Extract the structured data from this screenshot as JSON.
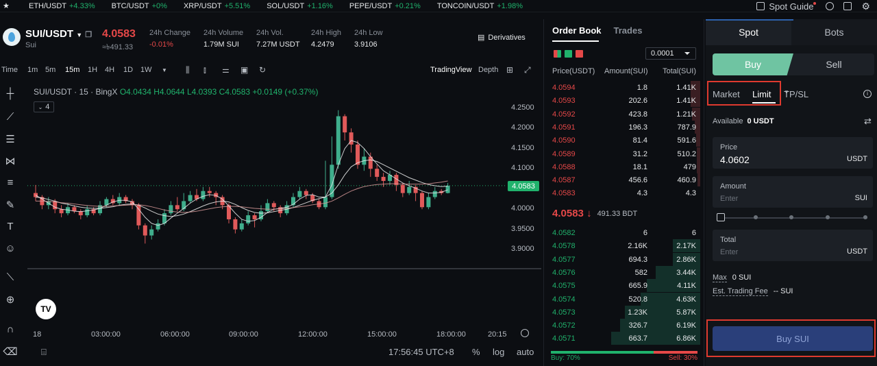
{
  "ticker": [
    {
      "pair": "ETH/USDT",
      "chg": "+4.33%"
    },
    {
      "pair": "BTC/USDT",
      "chg": "+0%"
    },
    {
      "pair": "XRP/USDT",
      "chg": "+5.51%"
    },
    {
      "pair": "SOL/USDT",
      "chg": "+1.16%"
    },
    {
      "pair": "PEPE/USDT",
      "chg": "+0.21%"
    },
    {
      "pair": "TONCOIN/USDT",
      "chg": "+1.98%"
    }
  ],
  "top": {
    "spot_guide": "Spot Guide"
  },
  "header": {
    "pair": "SUI/USDT",
    "sub": "Sui",
    "price": "4.0583",
    "price_sub": "≈৳491.33",
    "stats": [
      {
        "label": "24h Change",
        "value": "-0.01%",
        "neg": true
      },
      {
        "label": "24h Volume",
        "value": "1.79M SUI"
      },
      {
        "label": "24h Vol.",
        "value": "7.27M USDT"
      },
      {
        "label": "24h High",
        "value": "4.2479"
      },
      {
        "label": "24h Low",
        "value": "3.9106"
      }
    ],
    "derivatives": "Derivatives"
  },
  "toolbar": {
    "time": "Time",
    "intervals": [
      "1m",
      "5m",
      "15m",
      "1H",
      "4H",
      "1D",
      "1W"
    ],
    "active": "15m",
    "tradingview": "TradingView",
    "depth": "Depth"
  },
  "legend": {
    "title": "SUI/USDT · 15 · BingX",
    "o": "O4.0434",
    "h": "H4.0644",
    "l": "L4.0393",
    "c": "C4.0583",
    "chg": "+0.0149 (+0.37%)",
    "ind_count": "4"
  },
  "chart_data": {
    "type": "candlestick",
    "title": "SUI/USDT · 15 · BingX",
    "y_ticks": [
      "4.2500",
      "4.2000",
      "4.1500",
      "4.1000",
      "4.0500",
      "4.0000",
      "3.9500",
      "3.9000"
    ],
    "ylim": [
      3.88,
      4.27
    ],
    "x_ticks": [
      "18",
      "03:00:00",
      "06:00:00",
      "09:00:00",
      "12:00:00",
      "15:00:00",
      "18:00:00",
      "20:15"
    ],
    "current_price": "4.0583",
    "candles": [
      [
        4.04,
        4.03,
        4.06,
        4.02
      ],
      [
        4.03,
        4.01,
        4.035,
        4.0
      ],
      [
        4.01,
        4.02,
        4.03,
        4.0
      ],
      [
        4.02,
        4.0,
        4.025,
        3.99
      ],
      [
        4.0,
        3.99,
        4.01,
        3.98
      ],
      [
        3.99,
        4.005,
        4.015,
        3.985
      ],
      [
        4.005,
        3.995,
        4.01,
        3.99
      ],
      [
        3.995,
        3.985,
        4.0,
        3.975
      ],
      [
        3.985,
        4.0,
        4.01,
        3.98
      ],
      [
        4.0,
        3.99,
        4.005,
        3.985
      ],
      [
        3.99,
        4.01,
        4.02,
        3.985
      ],
      [
        4.01,
        4.025,
        4.03,
        4.005
      ],
      [
        4.025,
        4.015,
        4.035,
        4.01
      ],
      [
        4.015,
        4.03,
        4.04,
        4.01
      ],
      [
        4.03,
        4.02,
        4.035,
        4.015
      ],
      [
        4.02,
        4.01,
        4.025,
        4.0
      ],
      [
        4.01,
        3.96,
        4.015,
        3.95
      ],
      [
        3.96,
        3.935,
        3.965,
        3.915
      ],
      [
        3.935,
        3.95,
        3.96,
        3.925
      ],
      [
        3.95,
        3.965,
        3.975,
        3.945
      ],
      [
        3.965,
        3.99,
        4.0,
        3.96
      ],
      [
        3.99,
        4.01,
        4.02,
        3.985
      ],
      [
        4.01,
        4.0,
        4.03,
        3.995
      ],
      [
        4.0,
        4.02,
        4.04,
        3.995
      ],
      [
        4.02,
        4.035,
        4.045,
        4.015
      ],
      [
        4.035,
        4.025,
        4.05,
        4.02
      ],
      [
        4.025,
        4.045,
        4.055,
        4.02
      ],
      [
        4.045,
        4.04,
        4.055,
        4.03
      ],
      [
        4.04,
        4.03,
        4.045,
        4.01
      ],
      [
        4.03,
        4.01,
        4.035,
        4.0
      ],
      [
        4.01,
        3.975,
        4.015,
        3.965
      ],
      [
        3.975,
        3.95,
        3.98,
        3.94
      ],
      [
        3.95,
        3.965,
        3.975,
        3.945
      ],
      [
        3.965,
        3.985,
        3.995,
        3.96
      ],
      [
        3.985,
        3.975,
        3.99,
        3.955
      ],
      [
        3.975,
        3.995,
        4.01,
        3.97
      ],
      [
        3.995,
        4.015,
        4.025,
        3.99
      ],
      [
        4.015,
        4.005,
        4.02,
        3.995
      ],
      [
        4.005,
        3.99,
        4.01,
        3.98
      ],
      [
        3.99,
        4.01,
        4.02,
        3.985
      ],
      [
        4.01,
        4.03,
        4.04,
        4.005
      ],
      [
        4.03,
        4.045,
        4.055,
        4.025
      ],
      [
        4.045,
        4.035,
        4.05,
        4.025
      ],
      [
        4.035,
        4.02,
        4.04,
        4.015
      ],
      [
        4.02,
        4.005,
        4.025,
        4.0
      ],
      [
        4.005,
        4.03,
        4.12,
        4.0
      ],
      [
        4.03,
        4.11,
        4.18,
        4.025
      ],
      [
        4.11,
        4.23,
        4.245,
        4.1
      ],
      [
        4.23,
        4.19,
        4.235,
        4.17
      ],
      [
        4.19,
        4.16,
        4.2,
        4.14
      ],
      [
        4.16,
        4.11,
        4.17,
        4.1
      ],
      [
        4.11,
        4.13,
        4.15,
        4.095
      ],
      [
        4.13,
        4.1,
        4.14,
        4.08
      ],
      [
        4.1,
        4.08,
        4.11,
        4.07
      ],
      [
        4.08,
        4.07,
        4.09,
        4.055
      ],
      [
        4.07,
        4.085,
        4.095,
        4.06
      ],
      [
        4.085,
        4.06,
        4.09,
        4.045
      ],
      [
        4.06,
        4.04,
        4.065,
        4.03
      ],
      [
        4.04,
        4.055,
        4.07,
        4.035
      ],
      [
        4.055,
        4.04,
        4.06,
        4.02
      ],
      [
        4.04,
        4.005,
        4.045,
        4.0
      ],
      [
        4.005,
        4.03,
        4.04,
        4.0
      ],
      [
        4.03,
        4.045,
        4.055,
        4.025
      ],
      [
        4.045,
        4.04,
        4.05,
        4.035
      ],
      [
        4.04,
        4.058,
        4.065,
        4.039
      ]
    ],
    "ma_lines": [
      {
        "color": "#e6e8ea",
        "values": [
          4.035,
          4.025,
          4.015,
          4.005,
          4.0,
          3.998,
          3.995,
          3.994,
          3.996,
          3.998,
          4.002,
          4.01,
          4.018,
          4.022,
          4.022,
          4.018,
          4.0,
          3.98,
          3.965,
          3.96,
          3.965,
          3.978,
          3.99,
          4.002,
          4.015,
          4.025,
          4.032,
          4.036,
          4.034,
          4.025,
          4.008,
          3.99,
          3.975,
          3.97,
          3.972,
          3.98,
          3.992,
          4.0,
          4.002,
          4.005,
          4.012,
          4.025,
          4.034,
          4.036,
          4.03,
          4.03,
          4.06,
          4.11,
          4.15,
          4.17,
          4.165,
          4.15,
          4.13,
          4.112,
          4.095,
          4.085,
          4.075,
          4.065,
          4.058,
          4.052,
          4.045,
          4.04,
          4.04,
          4.042,
          4.048
        ]
      },
      {
        "color": "#f0f0f0",
        "values": [
          4.03,
          4.028,
          4.024,
          4.02,
          4.015,
          4.012,
          4.008,
          4.005,
          4.003,
          4.002,
          4.002,
          4.004,
          4.006,
          4.01,
          4.012,
          4.013,
          4.01,
          4.003,
          3.995,
          3.988,
          3.984,
          3.982,
          3.984,
          3.988,
          3.994,
          4.001,
          4.008,
          4.014,
          4.018,
          4.02,
          4.018,
          4.012,
          4.004,
          3.997,
          3.992,
          3.99,
          3.991,
          3.994,
          3.997,
          4.0,
          4.004,
          4.01,
          4.016,
          4.022,
          4.026,
          4.03,
          4.04,
          4.06,
          4.085,
          4.105,
          4.115,
          4.12,
          4.122,
          4.118,
          4.11,
          4.102,
          4.094,
          4.086,
          4.078,
          4.072,
          4.066,
          4.061,
          4.058,
          4.056,
          4.057
        ]
      },
      {
        "color": "#d99a9a",
        "values": [
          4.02,
          4.02,
          4.019,
          4.018,
          4.016,
          4.015,
          4.013,
          4.011,
          4.009,
          4.008,
          4.007,
          4.007,
          4.008,
          4.009,
          4.01,
          4.011,
          4.011,
          4.009,
          4.006,
          4.002,
          3.998,
          3.995,
          3.993,
          3.992,
          3.993,
          3.995,
          3.998,
          4.001,
          4.004,
          4.006,
          4.007,
          4.007,
          4.006,
          4.004,
          4.002,
          4.001,
          4.0,
          4.0,
          4.001,
          4.002,
          4.004,
          4.006,
          4.008,
          4.011,
          4.013,
          4.015,
          4.02,
          4.028,
          4.037,
          4.045,
          4.051,
          4.056,
          4.059,
          4.061,
          4.062,
          4.063,
          4.063,
          4.062,
          4.062,
          4.062,
          4.062,
          4.063,
          4.065,
          4.067,
          4.07
        ]
      }
    ]
  },
  "bottom": {
    "time": "17:56:45 UTC+8",
    "pct": "%",
    "log": "log",
    "auto": "auto"
  },
  "orderbook": {
    "tabs": [
      "Order Book",
      "Trades"
    ],
    "tick": "0.0001",
    "headers": [
      "Price(USDT)",
      "Amount(SUI)",
      "Total(SUI)"
    ],
    "asks": [
      {
        "price": "4.0594",
        "amount": "1.8",
        "total": "1.41K",
        "depth": 0.2
      },
      {
        "price": "4.0593",
        "amount": "202.6",
        "total": "1.41K",
        "depth": 0.2
      },
      {
        "price": "4.0592",
        "amount": "423.8",
        "total": "1.21K",
        "depth": 0.17
      },
      {
        "price": "4.0591",
        "amount": "196.3",
        "total": "787.9",
        "depth": 0.11
      },
      {
        "price": "4.0590",
        "amount": "81.4",
        "total": "591.6",
        "depth": 0.09
      },
      {
        "price": "4.0589",
        "amount": "31.2",
        "total": "510.2",
        "depth": 0.07
      },
      {
        "price": "4.0588",
        "amount": "18.1",
        "total": "479",
        "depth": 0.07
      },
      {
        "price": "4.0587",
        "amount": "456.6",
        "total": "460.9",
        "depth": 0.06
      },
      {
        "price": "4.0583",
        "amount": "4.3",
        "total": "4.3",
        "depth": 0.0
      }
    ],
    "mid_price": "4.0583",
    "mid_arrow": "↓",
    "mid_sub": "491.33 BDT",
    "bids": [
      {
        "price": "4.0582",
        "amount": "6",
        "total": "6",
        "depth": 0.0
      },
      {
        "price": "4.0578",
        "amount": "2.16K",
        "total": "2.17K",
        "depth": 0.31
      },
      {
        "price": "4.0577",
        "amount": "694.3",
        "total": "2.86K",
        "depth": 0.31
      },
      {
        "price": "4.0576",
        "amount": "582",
        "total": "3.44K",
        "depth": 0.5
      },
      {
        "price": "4.0575",
        "amount": "665.9",
        "total": "4.11K",
        "depth": 0.6
      },
      {
        "price": "4.0574",
        "amount": "520.8",
        "total": "4.63K",
        "depth": 0.67
      },
      {
        "price": "4.0573",
        "amount": "1.23K",
        "total": "5.87K",
        "depth": 0.85
      },
      {
        "price": "4.0572",
        "amount": "326.7",
        "total": "6.19K",
        "depth": 0.9
      },
      {
        "price": "4.0571",
        "amount": "663.7",
        "total": "6.86K",
        "depth": 1.0
      }
    ],
    "buy_ratio": "Buy: 70%",
    "sell_ratio": "Sell: 30%"
  },
  "trade": {
    "tabs": [
      "Spot",
      "Bots"
    ],
    "buy": "Buy",
    "sell": "Sell",
    "order_types": [
      "Market",
      "Limit",
      "TP/SL"
    ],
    "available_label": "Available",
    "available_value": "0",
    "available_unit": "USDT",
    "price_label": "Price",
    "price_value": "4.0602",
    "price_unit": "USDT",
    "amount_label": "Amount",
    "amount_placeholder": "Enter",
    "amount_unit": "SUI",
    "total_label": "Total",
    "total_placeholder": "Enter",
    "total_unit": "USDT",
    "max_label": "Max",
    "max_value": "0 SUI",
    "fee_label": "Est. Trading Fee",
    "fee_value": "-- SUI",
    "buy_button": "Buy SUI"
  }
}
